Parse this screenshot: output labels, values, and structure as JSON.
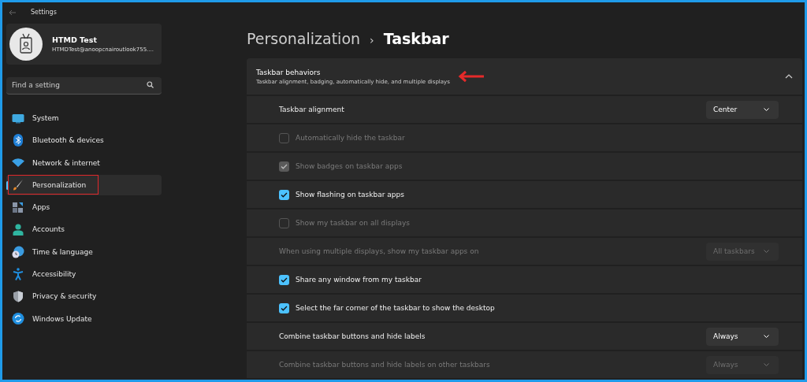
{
  "window": {
    "title": "Settings"
  },
  "profile": {
    "name": "HTMD Test",
    "email": "HTMDTest@anoopcnairoutlook755...."
  },
  "search": {
    "placeholder": "Find a setting"
  },
  "sidebar": {
    "items": [
      {
        "label": "System",
        "selected": false
      },
      {
        "label": "Bluetooth & devices",
        "selected": false
      },
      {
        "label": "Network & internet",
        "selected": false
      },
      {
        "label": "Personalization",
        "selected": true
      },
      {
        "label": "Apps",
        "selected": false
      },
      {
        "label": "Accounts",
        "selected": false
      },
      {
        "label": "Time & language",
        "selected": false
      },
      {
        "label": "Accessibility",
        "selected": false
      },
      {
        "label": "Privacy & security",
        "selected": false
      },
      {
        "label": "Windows Update",
        "selected": false
      }
    ]
  },
  "breadcrumb": {
    "parent": "Personalization",
    "separator": "›",
    "current": "Taskbar"
  },
  "section": {
    "title": "Taskbar behaviors",
    "subtitle": "Taskbar alignment, badging, automatically hide, and multiple displays",
    "expanded": true,
    "rows": [
      {
        "kind": "dropdown",
        "label": "Taskbar alignment",
        "value": "Center",
        "disabled": false
      },
      {
        "kind": "checkbox",
        "label": "Automatically hide the taskbar",
        "checked": false,
        "disabled": true
      },
      {
        "kind": "checkbox",
        "label": "Show badges on taskbar apps",
        "checked": true,
        "disabled": true
      },
      {
        "kind": "checkbox",
        "label": "Show flashing on taskbar apps",
        "checked": true,
        "disabled": false
      },
      {
        "kind": "checkbox",
        "label": "Show my taskbar on all displays",
        "checked": false,
        "disabled": true
      },
      {
        "kind": "dropdown",
        "label": "When using multiple displays, show my taskbar apps on",
        "value": "All taskbars",
        "disabled": true
      },
      {
        "kind": "checkbox",
        "label": "Share any window from my taskbar",
        "checked": true,
        "disabled": false
      },
      {
        "kind": "checkbox",
        "label": "Select the far corner of the taskbar to show the desktop",
        "checked": true,
        "disabled": false
      },
      {
        "kind": "dropdown",
        "label": "Combine taskbar buttons and hide labels",
        "value": "Always",
        "disabled": false
      },
      {
        "kind": "dropdown",
        "label": "Combine taskbar buttons and hide labels on other taskbars",
        "value": "Always",
        "disabled": true
      }
    ]
  }
}
